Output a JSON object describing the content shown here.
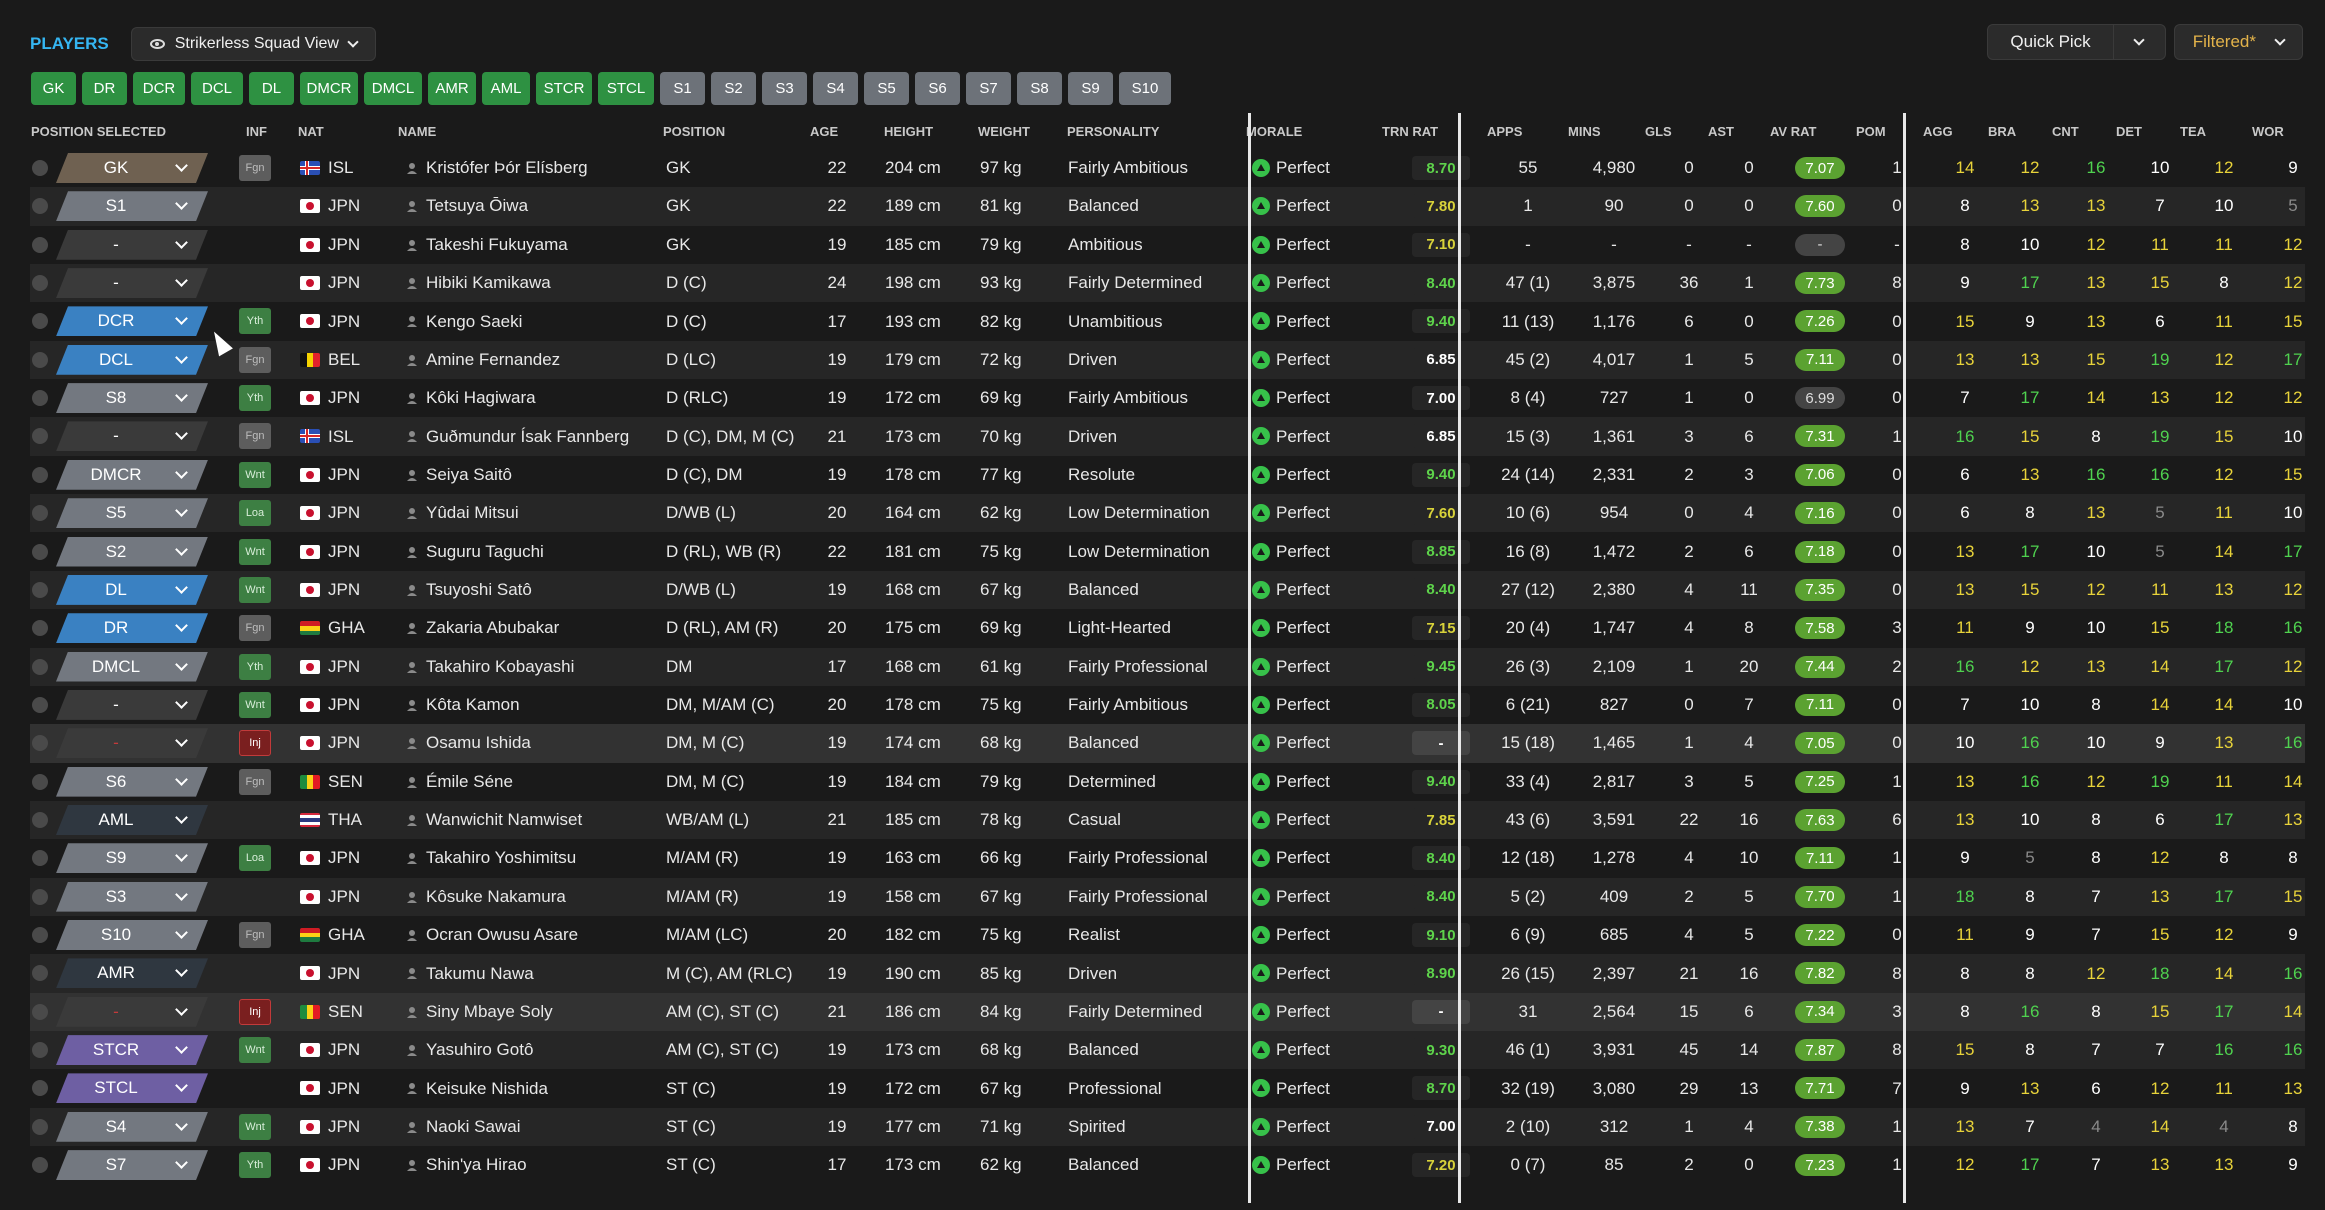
{
  "header": {
    "title": "PLAYERS",
    "view_label": "Strikerless Squad View",
    "quick_pick": "Quick Pick",
    "filtered": "Filtered*"
  },
  "position_chips": [
    "GK",
    "DR",
    "DCR",
    "DCL",
    "DL",
    "DMCR",
    "DMCL",
    "AMR",
    "AML",
    "STCR",
    "STCL"
  ],
  "slot_chips": [
    "S1",
    "S2",
    "S3",
    "S4",
    "S5",
    "S6",
    "S7",
    "S8",
    "S9",
    "S10"
  ],
  "columns": {
    "pos_sel": "POSITION SELECTED",
    "inf": "INF",
    "nat": "NAT",
    "name": "NAME",
    "position": "POSITION",
    "age": "AGE",
    "height": "HEIGHT",
    "weight": "WEIGHT",
    "personality": "PERSONALITY",
    "morale": "MORALE",
    "trn_rat": "TRN RAT",
    "apps": "APPS",
    "mins": "MINS",
    "gls": "GLS",
    "ast": "AST",
    "av_rat": "AV RAT",
    "pom": "POM",
    "agg": "AGG",
    "bra": "BRA",
    "cnt": "CNT",
    "det": "DET",
    "tea": "TEA",
    "wor": "WOR"
  },
  "colors": {
    "accent_blue": "#35b6f2",
    "green_chip": "#2e9142",
    "grey_chip": "#6d7279",
    "attr_yellow": "#e8d33a",
    "attr_green": "#4fd24f",
    "attr_white": "#ffffff",
    "attr_grey": "#8a8a8a"
  },
  "rows": [
    {
      "sel": "GK",
      "selc": "#6f6151",
      "inf": "Fgn",
      "nat": "ISL",
      "name": "Kristófer Þór Elísberg",
      "position": "GK",
      "age": "22",
      "height": "204 cm",
      "weight": "97 kg",
      "personality": "Fairly Ambitious",
      "morale": "Perfect",
      "trn": "8.70",
      "trnc": "#5ed34b",
      "apps": "55",
      "mins": "4,980",
      "gls": "0",
      "ast": "0",
      "av": "7.07",
      "pom": "1",
      "attrs": [
        "14",
        "12",
        "16",
        "10",
        "12",
        "9"
      ],
      "ac": [
        "y",
        "y",
        "g",
        "w",
        "y",
        "w"
      ]
    },
    {
      "sel": "S1",
      "selc": "#737880",
      "inf": "",
      "nat": "JPN",
      "name": "Tetsuya Ōiwa",
      "position": "GK",
      "age": "22",
      "height": "189 cm",
      "weight": "81 kg",
      "personality": "Balanced",
      "morale": "Perfect",
      "trn": "7.80",
      "trnc": "#d8d23a",
      "apps": "1",
      "mins": "90",
      "gls": "0",
      "ast": "0",
      "av": "7.60",
      "pom": "0",
      "attrs": [
        "8",
        "13",
        "13",
        "7",
        "10",
        "5"
      ],
      "ac": [
        "w",
        "y",
        "y",
        "w",
        "w",
        "x"
      ]
    },
    {
      "sel": "-",
      "selc": "#3a3a3a",
      "inf": "",
      "nat": "JPN",
      "name": "Takeshi Fukuyama",
      "position": "GK",
      "age": "19",
      "height": "185 cm",
      "weight": "79 kg",
      "personality": "Ambitious",
      "morale": "Perfect",
      "trn": "7.10",
      "trnc": "#d8d23a",
      "apps": "-",
      "mins": "-",
      "gls": "-",
      "ast": "-",
      "av": "-",
      "pom": "-",
      "attrs": [
        "8",
        "10",
        "12",
        "11",
        "11",
        "12"
      ],
      "ac": [
        "w",
        "w",
        "y",
        "y",
        "y",
        "y"
      ]
    },
    {
      "sel": "-",
      "selc": "#3a3a3a",
      "inf": "",
      "nat": "JPN",
      "name": "Hibiki Kamikawa",
      "position": "D (C)",
      "age": "24",
      "height": "198 cm",
      "weight": "93 kg",
      "personality": "Fairly Determined",
      "morale": "Perfect",
      "trn": "8.40",
      "trnc": "#5ed34b",
      "apps": "47 (1)",
      "mins": "3,875",
      "gls": "36",
      "ast": "1",
      "av": "7.73",
      "pom": "8",
      "attrs": [
        "9",
        "17",
        "13",
        "15",
        "8",
        "12"
      ],
      "ac": [
        "w",
        "g",
        "y",
        "y",
        "w",
        "y"
      ]
    },
    {
      "sel": "DCR",
      "selc": "#3a81c2",
      "inf": "Yth",
      "nat": "JPN",
      "name": "Kengo Saeki",
      "position": "D (C)",
      "age": "17",
      "height": "193 cm",
      "weight": "82 kg",
      "personality": "Unambitious",
      "morale": "Perfect",
      "trn": "9.40",
      "trnc": "#5ed34b",
      "apps": "11 (13)",
      "mins": "1,176",
      "gls": "6",
      "ast": "0",
      "av": "7.26",
      "pom": "0",
      "attrs": [
        "15",
        "9",
        "13",
        "6",
        "11",
        "15"
      ],
      "ac": [
        "y",
        "w",
        "y",
        "w",
        "y",
        "y"
      ]
    },
    {
      "sel": "DCL",
      "selc": "#3a81c2",
      "inf": "Fgn",
      "nat": "BEL",
      "name": "Amine Fernandez",
      "position": "D (LC)",
      "age": "19",
      "height": "179 cm",
      "weight": "72 kg",
      "personality": "Driven",
      "morale": "Perfect",
      "trn": "6.85",
      "trnc": "#ffffff",
      "apps": "45 (2)",
      "mins": "4,017",
      "gls": "1",
      "ast": "5",
      "av": "7.11",
      "pom": "0",
      "attrs": [
        "13",
        "13",
        "15",
        "19",
        "12",
        "17"
      ],
      "ac": [
        "y",
        "y",
        "y",
        "g",
        "y",
        "g"
      ]
    },
    {
      "sel": "S8",
      "selc": "#737880",
      "inf": "Yth",
      "nat": "JPN",
      "name": "Kôki Hagiwara",
      "position": "D (RLC)",
      "age": "19",
      "height": "172 cm",
      "weight": "69 kg",
      "personality": "Fairly Ambitious",
      "morale": "Perfect",
      "trn": "7.00",
      "trnc": "#ffffff",
      "apps": "8 (4)",
      "mins": "727",
      "gls": "1",
      "ast": "0",
      "av": "6.99",
      "pom": "0",
      "attrs": [
        "7",
        "17",
        "14",
        "13",
        "12",
        "12"
      ],
      "ac": [
        "w",
        "g",
        "y",
        "y",
        "y",
        "y"
      ]
    },
    {
      "sel": "-",
      "selc": "#3a3a3a",
      "inf": "Fgn",
      "nat": "ISL",
      "name": "Guðmundur Ísak Fannberg",
      "position": "D (C), DM, M (C)",
      "age": "21",
      "height": "173 cm",
      "weight": "70 kg",
      "personality": "Driven",
      "morale": "Perfect",
      "trn": "6.85",
      "trnc": "#ffffff",
      "apps": "15 (3)",
      "mins": "1,361",
      "gls": "3",
      "ast": "6",
      "av": "7.31",
      "pom": "1",
      "attrs": [
        "16",
        "15",
        "8",
        "19",
        "15",
        "10"
      ],
      "ac": [
        "g",
        "y",
        "w",
        "g",
        "y",
        "w"
      ]
    },
    {
      "sel": "DMCR",
      "selc": "#737880",
      "inf": "Wnt",
      "nat": "JPN",
      "name": "Seiya Saitô",
      "position": "D (C), DM",
      "age": "19",
      "height": "178 cm",
      "weight": "77 kg",
      "personality": "Resolute",
      "morale": "Perfect",
      "trn": "9.40",
      "trnc": "#5ed34b",
      "apps": "24 (14)",
      "mins": "2,331",
      "gls": "2",
      "ast": "3",
      "av": "7.06",
      "pom": "0",
      "attrs": [
        "6",
        "13",
        "16",
        "16",
        "12",
        "15"
      ],
      "ac": [
        "w",
        "y",
        "g",
        "g",
        "y",
        "y"
      ]
    },
    {
      "sel": "S5",
      "selc": "#737880",
      "inf": "Loa",
      "nat": "JPN",
      "name": "Yûdai Mitsui",
      "position": "D/WB (L)",
      "age": "20",
      "height": "164 cm",
      "weight": "62 kg",
      "personality": "Low Determination",
      "morale": "Perfect",
      "trn": "7.60",
      "trnc": "#d8d23a",
      "apps": "10 (6)",
      "mins": "954",
      "gls": "0",
      "ast": "4",
      "av": "7.16",
      "pom": "0",
      "attrs": [
        "6",
        "8",
        "13",
        "5",
        "11",
        "10"
      ],
      "ac": [
        "w",
        "w",
        "y",
        "x",
        "y",
        "w"
      ]
    },
    {
      "sel": "S2",
      "selc": "#737880",
      "inf": "Wnt",
      "nat": "JPN",
      "name": "Suguru Taguchi",
      "position": "D (RL), WB (R)",
      "age": "22",
      "height": "181 cm",
      "weight": "75 kg",
      "personality": "Low Determination",
      "morale": "Perfect",
      "trn": "8.85",
      "trnc": "#5ed34b",
      "apps": "16 (8)",
      "mins": "1,472",
      "gls": "2",
      "ast": "6",
      "av": "7.18",
      "pom": "0",
      "attrs": [
        "13",
        "17",
        "10",
        "5",
        "14",
        "17"
      ],
      "ac": [
        "y",
        "g",
        "w",
        "x",
        "y",
        "g"
      ]
    },
    {
      "sel": "DL",
      "selc": "#3a81c2",
      "inf": "Wnt",
      "nat": "JPN",
      "name": "Tsuyoshi Satô",
      "position": "D/WB (L)",
      "age": "19",
      "height": "168 cm",
      "weight": "67 kg",
      "personality": "Balanced",
      "morale": "Perfect",
      "trn": "8.40",
      "trnc": "#5ed34b",
      "apps": "27 (12)",
      "mins": "2,380",
      "gls": "4",
      "ast": "11",
      "av": "7.35",
      "pom": "0",
      "attrs": [
        "13",
        "15",
        "12",
        "11",
        "13",
        "12"
      ],
      "ac": [
        "y",
        "y",
        "y",
        "y",
        "y",
        "y"
      ]
    },
    {
      "sel": "DR",
      "selc": "#3a81c2",
      "inf": "Fgn",
      "nat": "GHA",
      "name": "Zakaria Abubakar",
      "position": "D (RL), AM (R)",
      "age": "20",
      "height": "175 cm",
      "weight": "69 kg",
      "personality": "Light-Hearted",
      "morale": "Perfect",
      "trn": "7.15",
      "trnc": "#d8d23a",
      "apps": "20 (4)",
      "mins": "1,747",
      "gls": "4",
      "ast": "8",
      "av": "7.58",
      "pom": "3",
      "attrs": [
        "11",
        "9",
        "10",
        "15",
        "18",
        "16"
      ],
      "ac": [
        "y",
        "w",
        "w",
        "y",
        "g",
        "g"
      ]
    },
    {
      "sel": "DMCL",
      "selc": "#737880",
      "inf": "Yth",
      "nat": "JPN",
      "name": "Takahiro Kobayashi",
      "position": "DM",
      "age": "17",
      "height": "168 cm",
      "weight": "61 kg",
      "personality": "Fairly Professional",
      "morale": "Perfect",
      "trn": "9.45",
      "trnc": "#5ed34b",
      "apps": "26 (3)",
      "mins": "2,109",
      "gls": "1",
      "ast": "20",
      "av": "7.44",
      "pom": "2",
      "attrs": [
        "16",
        "12",
        "13",
        "14",
        "17",
        "12"
      ],
      "ac": [
        "g",
        "y",
        "y",
        "y",
        "g",
        "y"
      ]
    },
    {
      "sel": "-",
      "selc": "#3a3a3a",
      "inf": "Wnt",
      "nat": "JPN",
      "name": "Kôta Kamon",
      "position": "DM, M/AM (C)",
      "age": "20",
      "height": "178 cm",
      "weight": "75 kg",
      "personality": "Fairly Ambitious",
      "morale": "Perfect",
      "trn": "8.05",
      "trnc": "#5ed34b",
      "apps": "6 (21)",
      "mins": "827",
      "gls": "0",
      "ast": "7",
      "av": "7.11",
      "pom": "0",
      "attrs": [
        "7",
        "10",
        "8",
        "14",
        "14",
        "10"
      ],
      "ac": [
        "w",
        "w",
        "w",
        "y",
        "y",
        "w"
      ]
    },
    {
      "sel": "-",
      "selc": "#3a3a3a",
      "inf": "Inj",
      "nat": "JPN",
      "name": "Osamu Ishida",
      "position": "DM, M (C)",
      "age": "19",
      "height": "174 cm",
      "weight": "68 kg",
      "personality": "Balanced",
      "morale": "Perfect",
      "trn": "-",
      "trnc": "#ffffff",
      "apps": "15 (18)",
      "mins": "1,465",
      "gls": "1",
      "ast": "4",
      "av": "7.05",
      "pom": "0",
      "attrs": [
        "10",
        "16",
        "10",
        "9",
        "13",
        "16"
      ],
      "ac": [
        "w",
        "g",
        "w",
        "w",
        "y",
        "g"
      ]
    },
    {
      "sel": "S6",
      "selc": "#737880",
      "inf": "Fgn",
      "nat": "SEN",
      "name": "Émile Séne",
      "position": "DM, M (C)",
      "age": "19",
      "height": "184 cm",
      "weight": "79 kg",
      "personality": "Determined",
      "morale": "Perfect",
      "trn": "9.40",
      "trnc": "#5ed34b",
      "apps": "33 (4)",
      "mins": "2,817",
      "gls": "3",
      "ast": "5",
      "av": "7.25",
      "pom": "1",
      "attrs": [
        "13",
        "16",
        "12",
        "19",
        "11",
        "14"
      ],
      "ac": [
        "y",
        "g",
        "y",
        "g",
        "y",
        "y"
      ]
    },
    {
      "sel": "AML",
      "selc": "#2f3740",
      "inf": "",
      "nat": "THA",
      "name": "Wanwichit Namwiset",
      "position": "WB/AM (L)",
      "age": "21",
      "height": "185 cm",
      "weight": "78 kg",
      "personality": "Casual",
      "morale": "Perfect",
      "trn": "7.85",
      "trnc": "#d8d23a",
      "apps": "43 (6)",
      "mins": "3,591",
      "gls": "22",
      "ast": "16",
      "av": "7.63",
      "pom": "6",
      "attrs": [
        "13",
        "10",
        "8",
        "6",
        "17",
        "13"
      ],
      "ac": [
        "y",
        "w",
        "w",
        "w",
        "g",
        "y"
      ]
    },
    {
      "sel": "S9",
      "selc": "#737880",
      "inf": "Loa",
      "nat": "JPN",
      "name": "Takahiro Yoshimitsu",
      "position": "M/AM (R)",
      "age": "19",
      "height": "163 cm",
      "weight": "66 kg",
      "personality": "Fairly Professional",
      "morale": "Perfect",
      "trn": "8.40",
      "trnc": "#5ed34b",
      "apps": "12 (18)",
      "mins": "1,278",
      "gls": "4",
      "ast": "10",
      "av": "7.11",
      "pom": "1",
      "attrs": [
        "9",
        "5",
        "8",
        "12",
        "8",
        "8"
      ],
      "ac": [
        "w",
        "x",
        "w",
        "y",
        "w",
        "w"
      ]
    },
    {
      "sel": "S3",
      "selc": "#737880",
      "inf": "",
      "nat": "JPN",
      "name": "Kôsuke Nakamura",
      "position": "M/AM (R)",
      "age": "19",
      "height": "158 cm",
      "weight": "67 kg",
      "personality": "Fairly Professional",
      "morale": "Perfect",
      "trn": "8.40",
      "trnc": "#5ed34b",
      "apps": "5 (2)",
      "mins": "409",
      "gls": "2",
      "ast": "5",
      "av": "7.70",
      "pom": "1",
      "attrs": [
        "18",
        "8",
        "7",
        "13",
        "17",
        "15"
      ],
      "ac": [
        "g",
        "w",
        "w",
        "y",
        "g",
        "y"
      ]
    },
    {
      "sel": "S10",
      "selc": "#737880",
      "inf": "Fgn",
      "nat": "GHA",
      "name": "Ocran Owusu Asare",
      "position": "M/AM (LC)",
      "age": "20",
      "height": "182 cm",
      "weight": "75 kg",
      "personality": "Realist",
      "morale": "Perfect",
      "trn": "9.10",
      "trnc": "#5ed34b",
      "apps": "6 (9)",
      "mins": "685",
      "gls": "4",
      "ast": "5",
      "av": "7.22",
      "pom": "0",
      "attrs": [
        "11",
        "9",
        "7",
        "15",
        "12",
        "9"
      ],
      "ac": [
        "y",
        "w",
        "w",
        "y",
        "y",
        "w"
      ]
    },
    {
      "sel": "AMR",
      "selc": "#2f3740",
      "inf": "",
      "nat": "JPN",
      "name": "Takumu Nawa",
      "position": "M (C), AM (RLC)",
      "age": "19",
      "height": "190 cm",
      "weight": "85 kg",
      "personality": "Driven",
      "morale": "Perfect",
      "trn": "8.90",
      "trnc": "#5ed34b",
      "apps": "26 (15)",
      "mins": "2,397",
      "gls": "21",
      "ast": "16",
      "av": "7.82",
      "pom": "8",
      "attrs": [
        "8",
        "8",
        "12",
        "18",
        "14",
        "16"
      ],
      "ac": [
        "w",
        "w",
        "y",
        "g",
        "y",
        "g"
      ]
    },
    {
      "sel": "-",
      "selc": "#3a3a3a",
      "inf": "Inj",
      "nat": "SEN",
      "name": "Siny Mbaye Soly",
      "position": "AM (C), ST (C)",
      "age": "21",
      "height": "186 cm",
      "weight": "84 kg",
      "personality": "Fairly Determined",
      "morale": "Perfect",
      "trn": "-",
      "trnc": "#ffffff",
      "apps": "31",
      "mins": "2,564",
      "gls": "15",
      "ast": "6",
      "av": "7.34",
      "pom": "3",
      "attrs": [
        "8",
        "16",
        "8",
        "15",
        "17",
        "14"
      ],
      "ac": [
        "w",
        "g",
        "w",
        "y",
        "g",
        "y"
      ]
    },
    {
      "sel": "STCR",
      "selc": "#6e5fa3",
      "inf": "Wnt",
      "nat": "JPN",
      "name": "Yasuhiro Gotô",
      "position": "AM (C), ST (C)",
      "age": "19",
      "height": "173 cm",
      "weight": "68 kg",
      "personality": "Balanced",
      "morale": "Perfect",
      "trn": "9.30",
      "trnc": "#5ed34b",
      "apps": "46 (1)",
      "mins": "3,931",
      "gls": "45",
      "ast": "14",
      "av": "7.87",
      "pom": "8",
      "attrs": [
        "15",
        "8",
        "7",
        "7",
        "16",
        "16"
      ],
      "ac": [
        "y",
        "w",
        "w",
        "w",
        "g",
        "g"
      ]
    },
    {
      "sel": "STCL",
      "selc": "#6e5fa3",
      "inf": "",
      "nat": "JPN",
      "name": "Keisuke Nishida",
      "position": "ST (C)",
      "age": "19",
      "height": "172 cm",
      "weight": "67 kg",
      "personality": "Professional",
      "morale": "Perfect",
      "trn": "8.70",
      "trnc": "#5ed34b",
      "apps": "32 (19)",
      "mins": "3,080",
      "gls": "29",
      "ast": "13",
      "av": "7.71",
      "pom": "7",
      "attrs": [
        "9",
        "13",
        "6",
        "12",
        "11",
        "13"
      ],
      "ac": [
        "w",
        "y",
        "w",
        "y",
        "y",
        "y"
      ]
    },
    {
      "sel": "S4",
      "selc": "#737880",
      "inf": "Wnt",
      "nat": "JPN",
      "name": "Naoki Sawai",
      "position": "ST (C)",
      "age": "19",
      "height": "177 cm",
      "weight": "71 kg",
      "personality": "Spirited",
      "morale": "Perfect",
      "trn": "7.00",
      "trnc": "#ffffff",
      "apps": "2 (10)",
      "mins": "312",
      "gls": "1",
      "ast": "4",
      "av": "7.38",
      "pom": "1",
      "attrs": [
        "13",
        "7",
        "4",
        "14",
        "4",
        "8"
      ],
      "ac": [
        "y",
        "w",
        "x",
        "y",
        "x",
        "w"
      ]
    },
    {
      "sel": "S7",
      "selc": "#737880",
      "inf": "Yth",
      "nat": "JPN",
      "name": "Shin'ya Hirao",
      "position": "ST (C)",
      "age": "17",
      "height": "173 cm",
      "weight": "62 kg",
      "personality": "Balanced",
      "morale": "Perfect",
      "trn": "7.20",
      "trnc": "#d8d23a",
      "apps": "0 (7)",
      "mins": "85",
      "gls": "2",
      "ast": "0",
      "av": "7.23",
      "pom": "1",
      "attrs": [
        "12",
        "17",
        "7",
        "13",
        "13",
        "9"
      ],
      "ac": [
        "y",
        "g",
        "w",
        "y",
        "y",
        "w"
      ]
    }
  ]
}
